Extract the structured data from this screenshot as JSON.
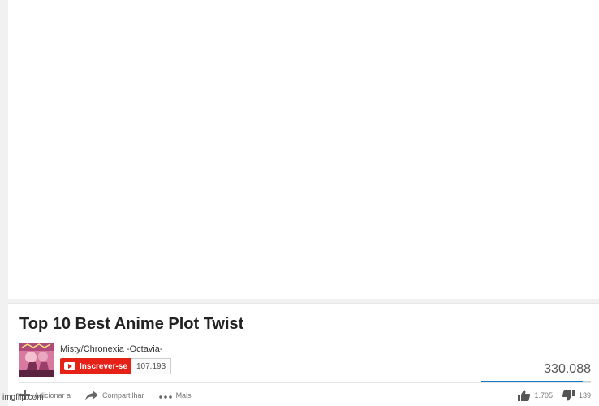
{
  "video": {
    "title": "Top 10 Best Anime Plot Twist",
    "views": "330.088",
    "likes_fraction": 0.925
  },
  "channel": {
    "name": "Misty/Chronexia -Octavia-",
    "subscribe_label": "Inscrever-se",
    "subscriber_count": "107.193"
  },
  "actions": {
    "add_to": "Adicionar a",
    "share": "Compartilhar",
    "more": "Mais"
  },
  "rating": {
    "likes": "1.705",
    "dislikes": "139"
  },
  "watermark": "imgflip.com",
  "colors": {
    "subscribe_red": "#e62117",
    "sentiment_blue": "#167ac6"
  }
}
